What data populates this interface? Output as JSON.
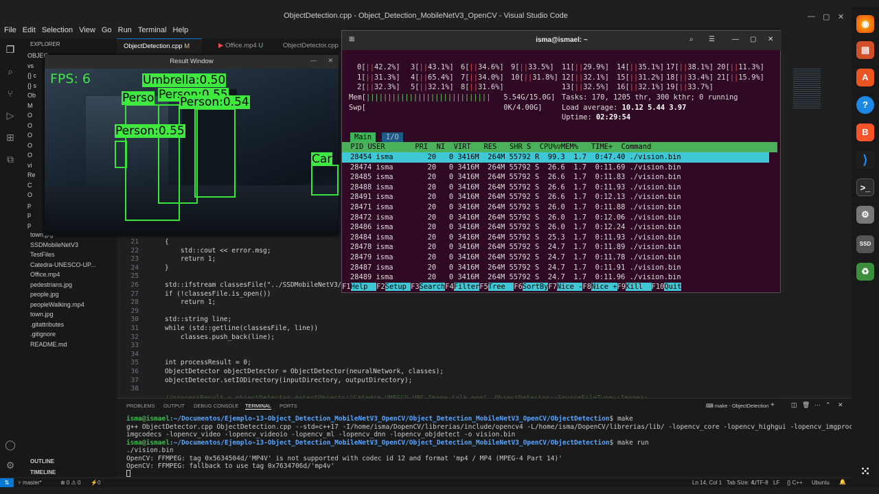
{
  "window": {
    "title": "ObjectDetection.cpp - Object_Detection_MobileNetV3_OpenCV - Visual Studio Code"
  },
  "menu": [
    "File",
    "Edit",
    "Selection",
    "View",
    "Go",
    "Run",
    "Terminal",
    "Help"
  ],
  "explorer": {
    "header": "EXPLORER",
    "rows": [
      "OBJEC",
      "vs",
      "{}  c",
      "{}  s",
      "Ob",
      "M",
      "O",
      "O",
      "O",
      "O",
      "O",
      "vi",
      "Re",
      "C",
      "O",
      "p",
      "p",
      "p",
      "town.jpg",
      "SSDMobileNetV3",
      "TestFiles",
      "Catedra-UNESCO-UP...",
      "Office.mp4",
      "pedestrians.jpg",
      "people.jpg",
      "peopleWalking.mp4",
      "town.jpg",
      ".gitattributes",
      ".gitignore",
      "README.md"
    ],
    "outline": "OUTLINE",
    "timeline": "TIMELINE"
  },
  "tabs": [
    {
      "label": "ObjectDetection.cpp",
      "badge": "M"
    },
    {
      "label": "Office.mp4",
      "badge": "U"
    },
    {
      "label": "ObjectDetector.cpp",
      "badge": ""
    }
  ],
  "editor": {
    "line_numbers": [
      "21",
      "22",
      "23",
      "24",
      "25",
      "26",
      "27",
      "28",
      "29",
      "30",
      "31",
      "32",
      "33",
      "34",
      "35",
      "36",
      "37",
      "38"
    ],
    "lines": [
      "{",
      "    std::cout << error.msg;",
      "    return 1;",
      "}",
      "",
      "std::ifstream classesFile(\"../SSDMobileNetV3/",
      "if (!classesFile.is_open())",
      "    return 1;",
      "",
      "std::string line;",
      "while (std::getline(classesFile, line))",
      "    classes.push_back(line);",
      "",
      "",
      "int processResult = 0;",
      "ObjectDetector objectDetector = ObjectDetector(neuralNetwork, classes);",
      "objectDetector.setIODirectory(inputDirectory, outputDirectory);",
      ""
    ],
    "faded": "//processResult = objectDetector.detectObjects(\"Catedra-UNESCO-UPC-Image-talk.png\", ObjectDetector::SourceFileType::Image);"
  },
  "result_window": {
    "title": "Result Window",
    "fps": "FPS: 6",
    "labels": [
      "Umbrella:0.50",
      "Person:0.55",
      "Perso",
      "Person:0.54",
      "Person:0.55",
      "Car"
    ]
  },
  "htop": {
    "title": "isma@ismael: ~",
    "cpus": [
      {
        "id": "0",
        "pct": "42.2%"
      },
      {
        "id": "1",
        "pct": "31.3%"
      },
      {
        "id": "2",
        "pct": "32.3%"
      },
      {
        "id": "3",
        "pct": "43.1%"
      },
      {
        "id": "4",
        "pct": "65.4%"
      },
      {
        "id": "5",
        "pct": "32.1%"
      },
      {
        "id": "6",
        "pct": "34.6%"
      },
      {
        "id": "7",
        "pct": "34.0%"
      },
      {
        "id": "8",
        "pct": "31.6%"
      },
      {
        "id": "9",
        "pct": "33.5%"
      },
      {
        "id": "10",
        "pct": "31.8%"
      },
      {
        "id": "11",
        "pct": "29.9%"
      },
      {
        "id": "12",
        "pct": "32.1%"
      },
      {
        "id": "13",
        "pct": "32.5%"
      },
      {
        "id": "14",
        "pct": "35.1%"
      },
      {
        "id": "15",
        "pct": "31.2%"
      },
      {
        "id": "16",
        "pct": "32.1%"
      },
      {
        "id": "17",
        "pct": "38.1%"
      },
      {
        "id": "18",
        "pct": "33.4%"
      },
      {
        "id": "19",
        "pct": "33.7%"
      },
      {
        "id": "20",
        "pct": "11.3%"
      },
      {
        "id": "21",
        "pct": "15.9%"
      }
    ],
    "mem": "5.54G/15.0G",
    "swp": "0K/4.00G",
    "tasks": "Tasks: 170, 1205 thr, 300 kthr; 0 running",
    "load": "Load average: ",
    "load_values": "10.12 5.44 3.97",
    "uptime_label": "Uptime: ",
    "uptime": "02:29:54",
    "tab_main": "Main",
    "tab_io": "I/O",
    "columns": "  PID USER       PRI  NI  VIRT   RES   SHR S  CPU%▽MEM%   TIME+  Command",
    "processes": [
      "28454 isma        20   0 3416M  264M 55792 R  99.3  1.7  0:47.40 ./vision.bin",
      "28474 isma        20   0 3416M  264M 55792 S  26.6  1.7  0:11.69 ./vision.bin",
      "28485 isma        20   0 3416M  264M 55792 S  26.6  1.7  0:11.83 ./vision.bin",
      "28488 isma        20   0 3416M  264M 55792 S  26.6  1.7  0:11.93 ./vision.bin",
      "28491 isma        20   0 3416M  264M 55792 S  26.6  1.7  0:12.13 ./vision.bin",
      "28471 isma        20   0 3416M  264M 55792 S  26.0  1.7  0:11.88 ./vision.bin",
      "28472 isma        20   0 3416M  264M 55792 S  26.0  1.7  0:12.06 ./vision.bin",
      "28486 isma        20   0 3416M  264M 55792 S  26.0  1.7  0:12.24 ./vision.bin",
      "28484 isma        20   0 3416M  264M 55792 S  25.3  1.7  0:11.93 ./vision.bin",
      "28478 isma        20   0 3416M  264M 55792 S  24.7  1.7  0:11.89 ./vision.bin",
      "28479 isma        20   0 3416M  264M 55792 S  24.7  1.7  0:11.78 ./vision.bin",
      "28487 isma        20   0 3416M  264M 55792 S  24.7  1.7  0:11.91 ./vision.bin",
      "28489 isma        20   0 3416M  264M 55792 S  24.7  1.7  0:11.96 ./vision.bin"
    ],
    "fkeys": [
      {
        "k": "F1",
        "v": "Help  "
      },
      {
        "k": "F2",
        "v": "Setup "
      },
      {
        "k": "F3",
        "v": "Search"
      },
      {
        "k": "F4",
        "v": "Filter"
      },
      {
        "k": "F5",
        "v": "Tree  "
      },
      {
        "k": "F6",
        "v": "SortBy"
      },
      {
        "k": "F7",
        "v": "Nice -"
      },
      {
        "k": "F8",
        "v": "Nice +"
      },
      {
        "k": "F9",
        "v": "Kill  "
      },
      {
        "k": "F10",
        "v": "Quit"
      }
    ]
  },
  "panel": {
    "tabs": [
      "PROBLEMS",
      "OUTPUT",
      "DEBUG CONSOLE",
      "TERMINAL",
      "PORTS"
    ],
    "terminal_name": "make - ObjectDetection",
    "prompt": "isma@ismael",
    "path": ":~/Documentos/Ejemplo-13-Object_Detection_MobileNetV3_OpenCV/Object_Detection_MobileNetV3_OpenCV/ObjectDetection",
    "cmd1": "$ make",
    "out1": "g++ ObjectDetector.cpp ObjectDetection.cpp --std=c++17 -I/home/isma/DopenCV/librerias/include/opencv4 -L/home/isma/DopenCV/librerias/lib/ -lopencv_core -lopencv_highgui -lopencv_imgproc -lopencv_",
    "out2": "imgcodecs -lopencv_video -lopencv_videoio -lopencv_ml -lopencv_dnn -lopencv_objdetect -o vision.bin",
    "cmd2": "$ make run",
    "out3": "./vision.bin",
    "out4": "OpenCV: FFMPEG: tag 0x5634504d/'MP4V' is not supported with codec id 12 and format 'mp4 / MP4 (MPEG-4 Part 14)'",
    "out5": "OpenCV: FFMPEG: fallback to use tag 0x7634706d/'mp4v'"
  },
  "status": {
    "branch": "master*",
    "errors": "⊗ 0 ⚠ 0",
    "ports": "⚡0",
    "position": "Ln 14, Col 1",
    "tab_size": "Tab Size: 4",
    "encoding": "UTF-8",
    "eol": "LF",
    "lang": "{} C++",
    "os": "Ubuntu"
  },
  "colors": {
    "accent": "#3fe93f",
    "terminal_bg": "#300a24",
    "cyan": "#3fc7d5"
  }
}
